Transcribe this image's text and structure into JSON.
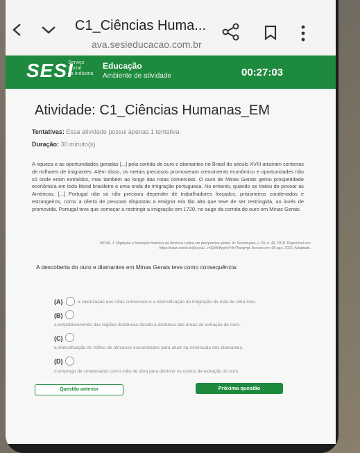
{
  "browser": {
    "tab_title": "C1_Ciências Huma...",
    "url": "ava.sesieducacao.com.br"
  },
  "header": {
    "logo": "SESI",
    "logo_sub": [
      "Serviço",
      "Social",
      "da Indústria"
    ],
    "title": "Educação",
    "subtitle": "Ambiente de atividade",
    "timer": "00:27:03"
  },
  "activity": {
    "title": "Atividade: C1_Ciências Humanas_EM",
    "attempts_label": "Tentativas:",
    "attempts_value": "Essa atividade possui apenas 1 tentativa",
    "duration_label": "Duração:",
    "duration_value": "30 minuto(s)"
  },
  "passage": "A riqueza e as oportunidades geradas [...] pela corrida de ouro e diamantes no Brasil do século XVIII atraíram centenas de milhares de imigrantes. Além disso, os metais preciosos promoveram crescimento econômico e oportunidades não só onde eram extraídos, mas também ao longo das rotas comerciais. O ouro de Minas Gerais gerou prosperidade econômica em todo litoral brasileiro e uma onda de imigração portuguesa. No entanto, quando se tratou de povoar as Américas, [...] Portugal não só não precisou depender de trabalhadores forçados, prisioneiros condenados e estrangeiros, como a oferta de pessoas dispostas a emigrar era tão alta que teve de ser restringida, ao invés de promovida. Portugal teve que começar a restringir a imigração em 1720, no auge da corrida do ouro em Minas Gerais.",
  "source": "MOVA, J. Migração e formação histórica da América Latina em perspectiva global. In: Sociologias, v. 20, n. 49, 2018. Disponível em: https://www.scielo.br/j/soc/a/...rhQdN4fyp4nYdv/?lang=pt. Acesso em: 08 ago. 2022. Adaptado.",
  "question": "A descoberta do ouro e diamantes em Minas Gerais teve como consequência:",
  "options": [
    {
      "letter": "(A)",
      "text": "a valorização das rotas comerciais e a intensificação da imigração de mão de obra livre."
    },
    {
      "letter": "(B)",
      "text": "o empobrecimento das regiões litorâneas devido à distância das áreas de extração do ouro."
    },
    {
      "letter": "(C)",
      "text": "a intensificação do tráfico de africanos escravizados para atuar na mineração dos diamantes."
    },
    {
      "letter": "(D)",
      "text": "o emprego de condenados como mão de obra para diminuir os custos de extração do ouro."
    }
  ],
  "buttons": {
    "prev": "Questão anterior",
    "next": "Próxima questão"
  },
  "colors": {
    "brand_green": "#1d8a3e"
  }
}
